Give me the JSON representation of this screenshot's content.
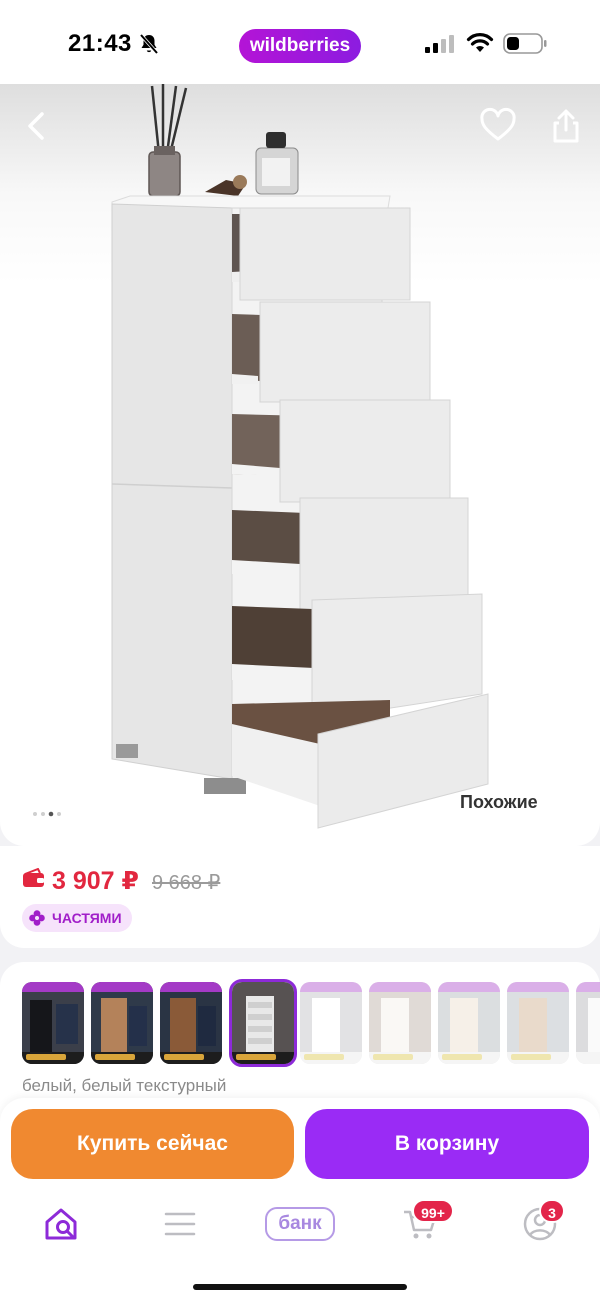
{
  "status_bar": {
    "time": "21:43",
    "app_label": "wildberries"
  },
  "gallery": {
    "similar_label": "Похожие",
    "total_images": 4,
    "current_image": 2
  },
  "price": {
    "current": "3 907 ₽",
    "old": "9 668 ₽",
    "installments_label": "ЧАСТЯМИ",
    "accent_color": "#e2273f"
  },
  "variants": {
    "selected_index": 3,
    "color_caption": "белый, белый текстурный",
    "items": [
      {
        "color": "black"
      },
      {
        "color": "walnut"
      },
      {
        "color": "dark-walnut"
      },
      {
        "color": "white",
        "selected": true
      },
      {
        "color": "white-glossy"
      },
      {
        "color": "white-oak"
      },
      {
        "color": "sonoma-white"
      },
      {
        "color": "light-wood"
      },
      {
        "color": "white-partial"
      }
    ]
  },
  "actions": {
    "buy_now": "Купить сейчас",
    "add_to_cart": "В корзину",
    "buy_color": "#f08930",
    "cart_color": "#9a2bf5"
  },
  "tabbar": {
    "bank_label": "банк",
    "cart_badge": "99+",
    "profile_badge": "3",
    "active": "home"
  }
}
